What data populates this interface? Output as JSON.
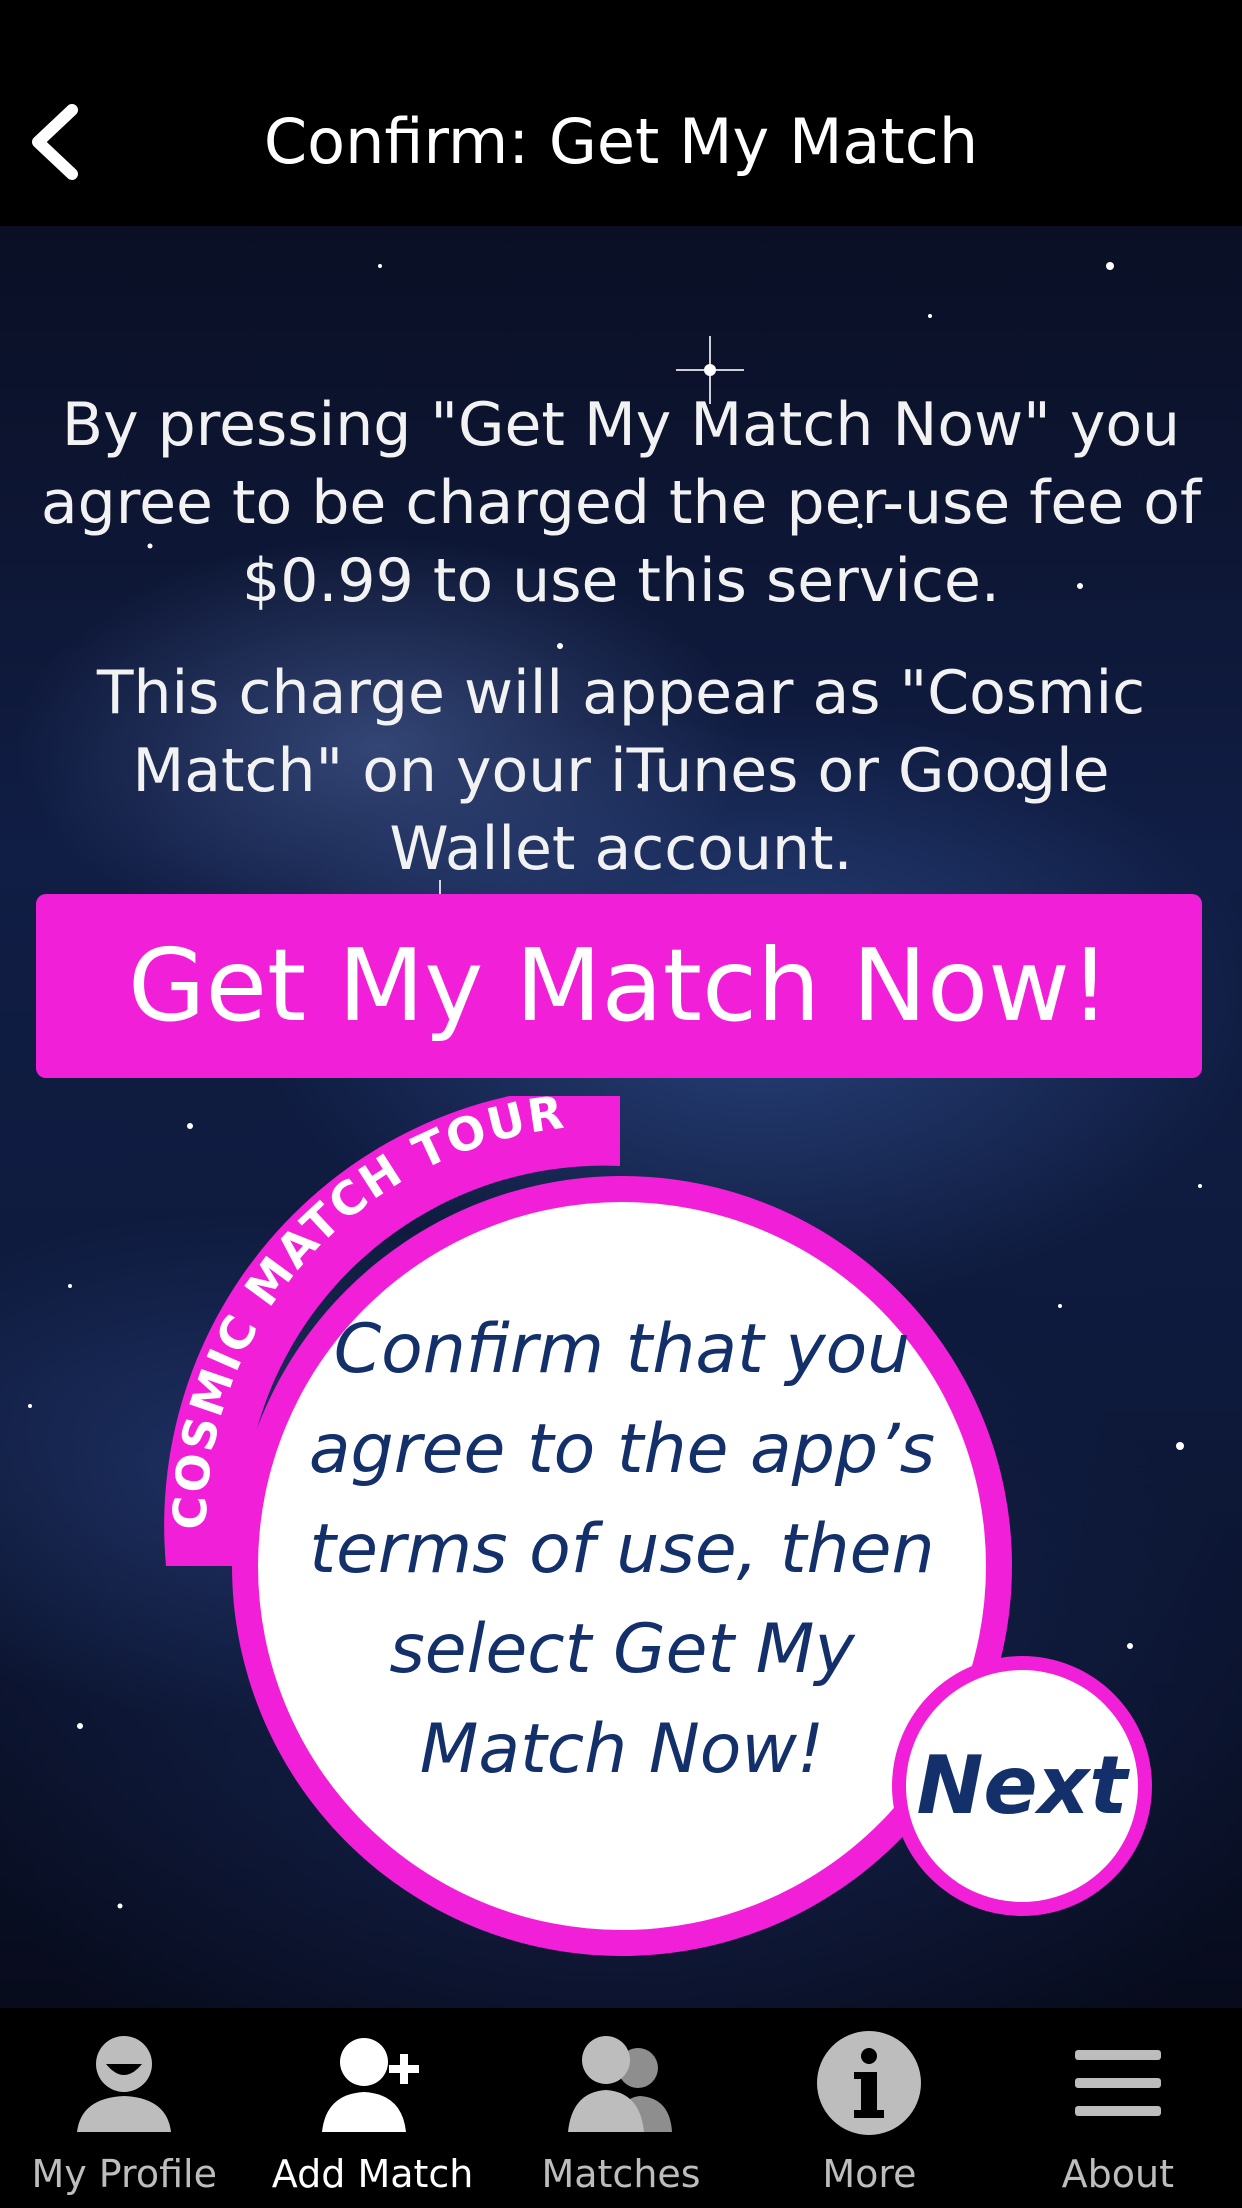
{
  "header": {
    "title": "Confirm: Get My Match",
    "back_icon": "chevron-left-icon"
  },
  "main": {
    "terms_paragraph": "By pressing \"Get My Match Now\" you agree to be charged the per-use fee of $0.99 to use this service.",
    "charge_paragraph": "This charge will appear as \"Cosmic Match\" on your iTunes or Google Wallet account.",
    "get_match_button": "Get My Match Now!"
  },
  "tour": {
    "banner": "COSMIC MATCH TOUR",
    "message": "Confirm that you agree to the app’s terms of use, then select Get My Match Now!",
    "next_button": "Next"
  },
  "tabbar": {
    "items": [
      {
        "label": "My Profile",
        "icon": "profile-icon",
        "active": false
      },
      {
        "label": "Add Match",
        "icon": "add-user-icon",
        "active": true
      },
      {
        "label": "Matches",
        "icon": "users-icon",
        "active": false
      },
      {
        "label": "More",
        "icon": "info-icon",
        "active": false
      },
      {
        "label": "About",
        "icon": "menu-icon",
        "active": false
      }
    ]
  },
  "colors": {
    "accent": "#f21fd9",
    "tour_text": "#14306b",
    "background": "#000000"
  }
}
